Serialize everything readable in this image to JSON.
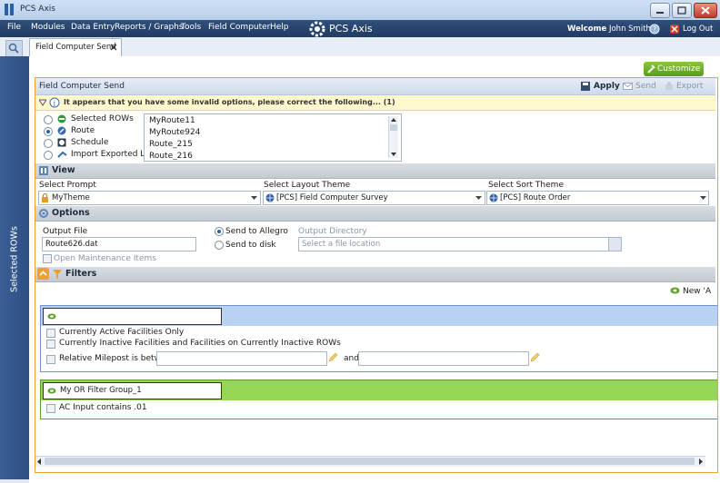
{
  "window": {
    "title": "PCS Axis"
  },
  "menu": {
    "items": [
      "File",
      "Modules",
      "Data Entry",
      "Reports / Graphs",
      "Tools",
      "Field Computer",
      "Help"
    ],
    "brand": "PCS Axis",
    "welcome_label": "Welcome",
    "user": "John Smith",
    "logout": "Log Out"
  },
  "tabs": {
    "active": "Field Computer Send"
  },
  "sidebar": {
    "label": "Selected ROWs"
  },
  "toolbar": {
    "customize": "Customize"
  },
  "panel": {
    "title": "Field Computer Send",
    "apply": "Apply",
    "send": "Send",
    "export": "Export",
    "warning": "It appears that you have some invalid options, please correct the following...  (1)"
  },
  "source_options": [
    "Selected ROWs",
    "Route",
    "Schedule",
    "Import Exported List"
  ],
  "route_list": [
    "MyRoute11",
    "MyRoute924",
    "Route_215",
    "Route_216"
  ],
  "view": {
    "title": "View",
    "prompt_label": "Select Prompt",
    "prompt_value": "MyTheme",
    "layout_label": "Select Layout Theme",
    "layout_value": "[PCS] Field Computer Survey",
    "sort_label": "Select Sort Theme",
    "sort_value": "[PCS] Route Order"
  },
  "options": {
    "title": "Options",
    "output_file_label": "Output File",
    "output_file_value": "Route626.dat",
    "send_allegro": "Send to Allegro",
    "send_disk": "Send to disk",
    "output_dir_label": "Output Directory",
    "output_dir_placeholder": "Select a file location",
    "open_maintenance": "Open Maintenance Items"
  },
  "filters": {
    "title": "Filters",
    "new_label": "New 'A",
    "and_group": {
      "name": "",
      "items": [
        "Currently Active Facilities Only",
        "Currently Inactive Facilities and Facilities on Currently Inactive ROWs"
      ],
      "milepost_label": "Relative Milepost is between",
      "and_label": "and"
    },
    "or_group": {
      "name": "My OR Filter Group_1",
      "item": "AC Input contains  .01"
    }
  },
  "colors": {
    "accent": "#f0a030",
    "menubar": "#2f4f7c",
    "customize": "#6aaa2a"
  }
}
